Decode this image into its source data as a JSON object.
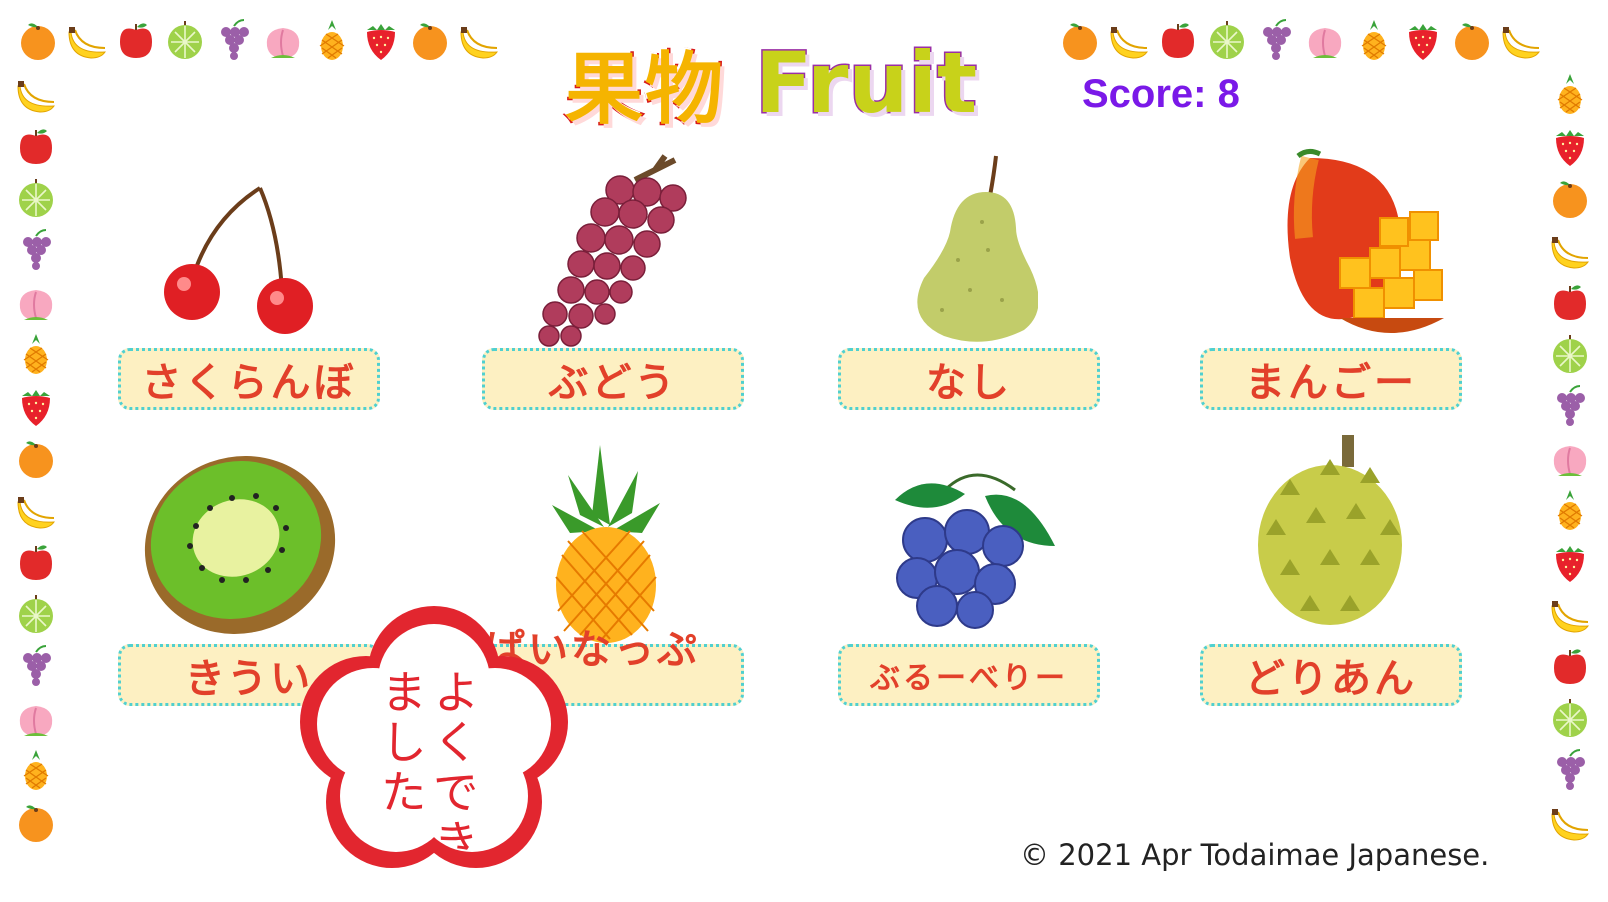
{
  "title": {
    "japanese": "果物",
    "english": "Fruit"
  },
  "score": {
    "text": "Score: 8"
  },
  "cards": [
    {
      "label": "さくらんぼ",
      "icon": "cherry-icon"
    },
    {
      "label": "ぶどう",
      "icon": "grape-icon"
    },
    {
      "label": "なし",
      "icon": "pear-icon"
    },
    {
      "label": "まんごー",
      "icon": "mango-icon"
    },
    {
      "label": "きうい",
      "icon": "kiwi-icon"
    },
    {
      "label": "ぱいなっぷる",
      "icon": "pineapple-icon"
    },
    {
      "label": "ぶるーべりー",
      "icon": "blueberry-icon"
    },
    {
      "label": "どりあん",
      "icon": "durian-icon"
    }
  ],
  "stamp": {
    "text": "よくできました"
  },
  "footer": {
    "copyright": "© 2021 Apr Todaimae Japanese."
  },
  "colors": {
    "label_text": "#e2402a",
    "label_bg": "#fdf0c2",
    "label_border": "#4fd0d0",
    "score": "#7a19e8",
    "stamp": "#e2262f"
  }
}
